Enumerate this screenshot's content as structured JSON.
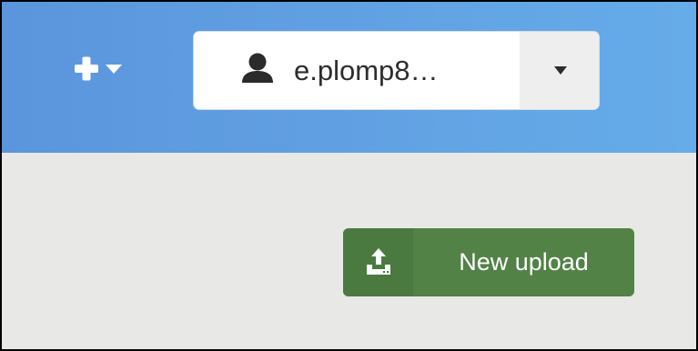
{
  "header": {
    "add_menu": {
      "icon": "plus-icon",
      "dropdown_icon": "caret-down-icon"
    },
    "user_menu": {
      "icon": "user-icon",
      "username": "e.plomp8…",
      "toggle_icon": "caret-down-icon"
    }
  },
  "main": {
    "upload_button": {
      "icon": "upload-icon",
      "label": "New upload"
    }
  },
  "colors": {
    "header_gradient_start": "#5b95dc",
    "header_gradient_end": "#66ace9",
    "content_background": "#e8e9e7",
    "upload_button": "#528246",
    "upload_button_icon_cell": "#4a7a3f"
  }
}
